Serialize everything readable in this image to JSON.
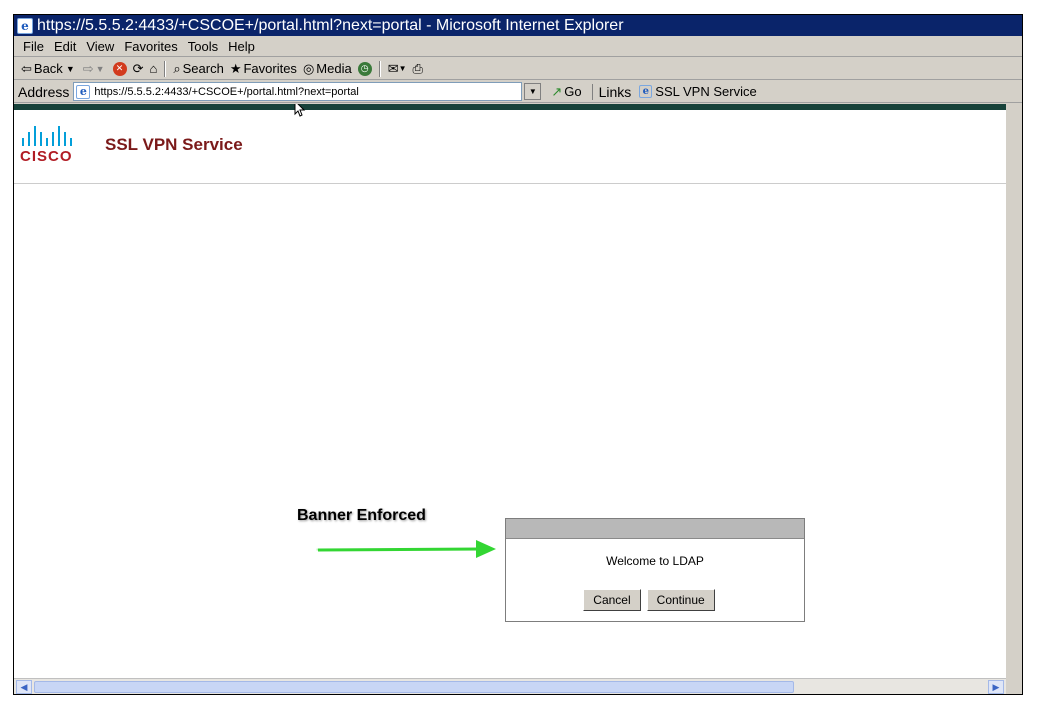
{
  "window": {
    "title": "https://5.5.5.2:4433/+CSCOE+/portal.html?next=portal - Microsoft Internet Explorer"
  },
  "menu": {
    "items": [
      {
        "label": "File"
      },
      {
        "label": "Edit"
      },
      {
        "label": "View"
      },
      {
        "label": "Favorites"
      },
      {
        "label": "Tools"
      },
      {
        "label": "Help"
      }
    ]
  },
  "toolbar": {
    "back_label": "Back",
    "search_label": "Search",
    "favorites_label": "Favorites",
    "media_label": "Media"
  },
  "address": {
    "label": "Address",
    "url": "https://5.5.5.2:4433/+CSCOE+/portal.html?next=portal",
    "go_label": "Go",
    "links_label": "Links",
    "link_item": "SSL VPN Service"
  },
  "page": {
    "logo_text": "CISCO",
    "service_title": "SSL VPN Service",
    "annotation": "Banner Enforced",
    "dialog": {
      "message": "Welcome to LDAP",
      "cancel_label": "Cancel",
      "continue_label": "Continue"
    }
  },
  "colors": {
    "titlebar": "#0a246a",
    "service_title": "#7b1a1a",
    "logo_text": "#b11c24",
    "logo_bars": "#049fd9",
    "arrow": "#33d633"
  }
}
